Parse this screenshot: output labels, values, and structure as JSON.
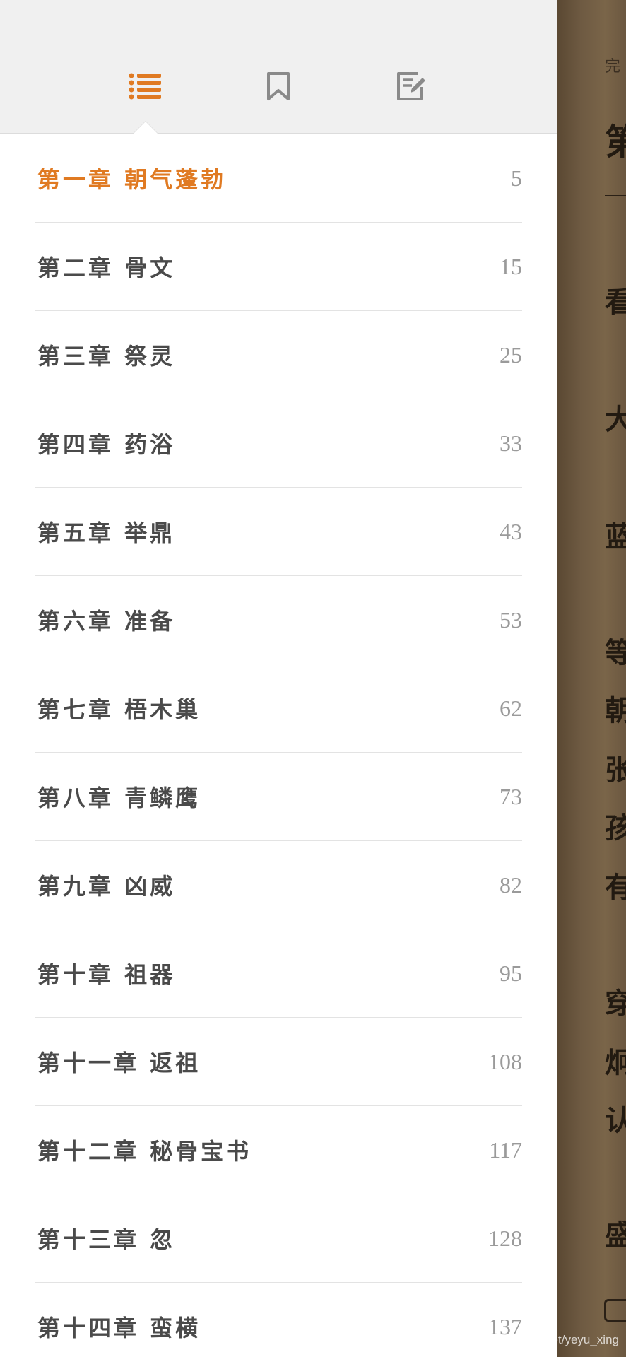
{
  "tabs": {
    "toc": {
      "icon": "list-icon",
      "active": true,
      "color": "#e07a22"
    },
    "bookmarks": {
      "icon": "bookmark-icon",
      "active": false
    },
    "notes": {
      "icon": "note-edit-icon",
      "active": false
    }
  },
  "toc": [
    {
      "title": "第一章 朝气蓬勃",
      "page": "5",
      "active": true
    },
    {
      "title": "第二章 骨文",
      "page": "15"
    },
    {
      "title": "第三章 祭灵",
      "page": "25"
    },
    {
      "title": "第四章 药浴",
      "page": "33"
    },
    {
      "title": "第五章 举鼎",
      "page": "43"
    },
    {
      "title": "第六章 准备",
      "page": "53"
    },
    {
      "title": "第七章 梧木巢",
      "page": "62"
    },
    {
      "title": "第八章 青鳞鹰",
      "page": "73"
    },
    {
      "title": "第九章 凶威",
      "page": "82"
    },
    {
      "title": "第十章 祖器",
      "page": "95"
    },
    {
      "title": "第十一章 返祖",
      "page": "108"
    },
    {
      "title": "第十二章 秘骨宝书",
      "page": "117"
    },
    {
      "title": "第十三章 忽",
      "page": "128"
    },
    {
      "title": "第十四章 蛮横",
      "page": "137"
    }
  ],
  "reader": {
    "header": "完",
    "glyphs": [
      "第",
      "看",
      "大",
      "蓝",
      "等",
      "朝",
      "张",
      "孩",
      "有",
      "穿",
      "炯",
      "认",
      "盛"
    ]
  },
  "watermark": "https://blog.csdn.net/yeyu_xing"
}
